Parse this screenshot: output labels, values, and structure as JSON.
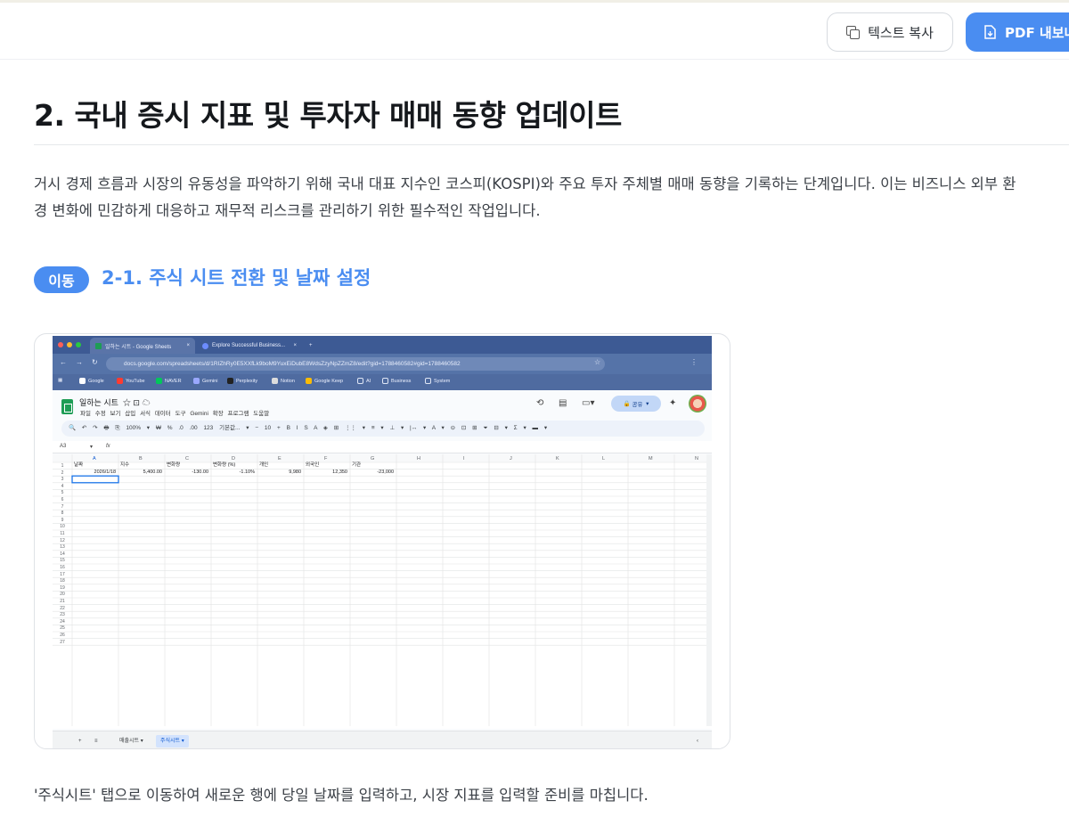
{
  "toolbar": {
    "copy_label": "텍스트 복사",
    "pdf_label": "PDF 내보내기"
  },
  "article": {
    "title": "2. 국내 증시 지표 및 투자자 매매 동향 업데이트",
    "intro_line1": "거시 경제 흐름과 시장의 유동성을 파악하기 위해 국내 대표 지수인 코스피(KOSPI)와 주요 투자 주체별 매매 동향을 기록하는 단계입니다. 이는 비즈니스 외부 환",
    "intro_line2": "경 변화에 민감하게 대응하고 재무적 리스크를 관리하기 위한 필수적인 작업입니다.",
    "step_badge": "이동",
    "step_title": "2-1. 주식 시트 전환 및 날짜 설정",
    "caption": "'주식시트' 탭으로 이동하여 새로운 행에 당일 날짜를 입력하고, 시장 지표를 입력할 준비를 마칩니다."
  },
  "screenshot": {
    "browser": {
      "tab1": "일하는 시트 - Google Sheets",
      "tab2": "Explore Successful Business...",
      "url": "docs.google.com/spreadsheets/d/1RIZhRy0E5XXfLk9boM9YuxEiDubE8WdsZzyNpZZmZ8/edit?gid=1788460582#gid=1788460582",
      "bookmarks": [
        "Google",
        "YouTube",
        "NAVER",
        "Gemini",
        "Perplexity",
        "Notion",
        "Google Keep",
        "AI",
        "Business",
        "System"
      ]
    },
    "sheets": {
      "doc_title": "일하는 시트",
      "menus": "파일  수정  보기  삽입  서식  데이터  도구  Gemini  확장 프로그램  도움말",
      "share_label": "공유",
      "toolbar_text": "🔍  ↶  ↷  🖶  ⎘  100% ▾  ₩  %  .0  .00  123  기본값... ▾  −  10  +  B  I  S  A  ◈  ⊞  ⋮⋮ ▾  ≡ ▾  ⊥ ▾  |↔ ▾  A ▾  ⊝  ⊡  ⊞  ⏷  ⊟ ▾  Σ ▾  ▬ ▾",
      "name_box": "A3",
      "fx": "fx",
      "columns": [
        "A",
        "B",
        "C",
        "D",
        "E",
        "F",
        "G",
        "H",
        "I",
        "J",
        "K",
        "L",
        "M",
        "N"
      ],
      "header_row": [
        "날짜",
        "지수",
        "변화량",
        "변화량 (%)",
        "개인",
        "외국인",
        "기관"
      ],
      "data_row": [
        "2026/1/18",
        "5,400.00",
        "-130.00",
        "-1.10%",
        "9,980",
        "12,350",
        "-23,000"
      ],
      "row_count": 27,
      "sheet_tabs": [
        "매출시트",
        "주식시트"
      ]
    }
  }
}
